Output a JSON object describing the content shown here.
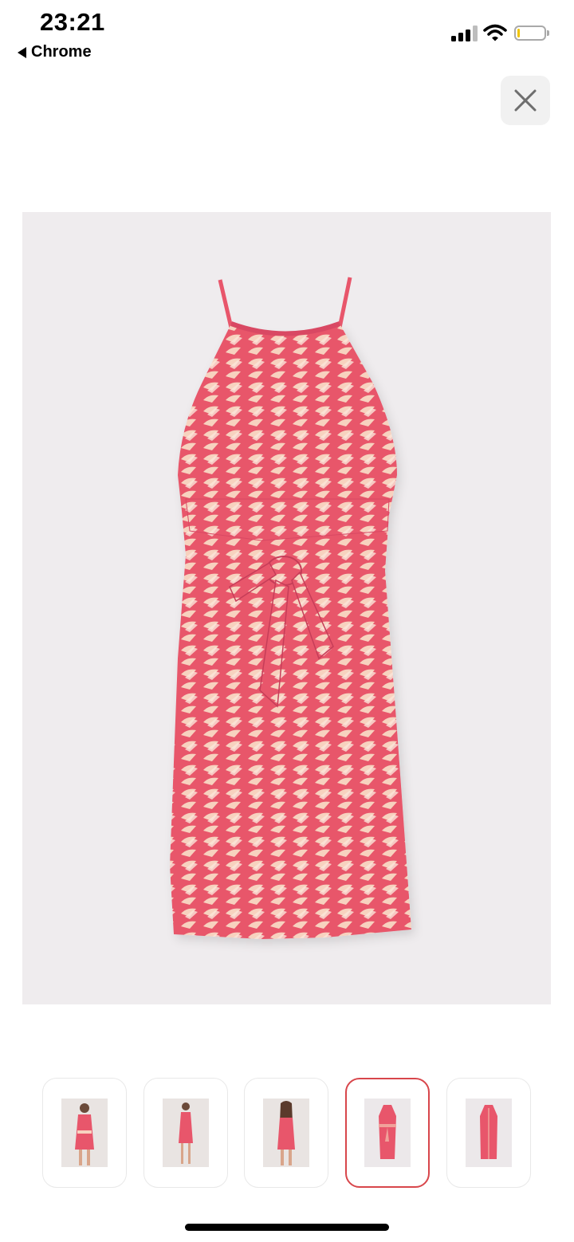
{
  "status_bar": {
    "time": "23:21",
    "back_app": "Chrome",
    "icons": [
      "signal-icon",
      "wifi-icon",
      "battery-icon"
    ],
    "battery_color": "#f0c400"
  },
  "viewer": {
    "close_icon": "close-icon",
    "main_image": "dress-flat-lay-image",
    "image_background": "#efecee"
  },
  "thumbnails": [
    {
      "name": "model-front-tied",
      "selected": false
    },
    {
      "name": "model-front-standing",
      "selected": false
    },
    {
      "name": "model-back",
      "selected": false
    },
    {
      "name": "dress-flat-front-tied",
      "selected": true
    },
    {
      "name": "dress-flat-plain",
      "selected": false
    }
  ],
  "colors": {
    "dress_pink": "#e8566b",
    "pattern_cream": "#f7d2bf",
    "selected_border": "#d8464b"
  }
}
